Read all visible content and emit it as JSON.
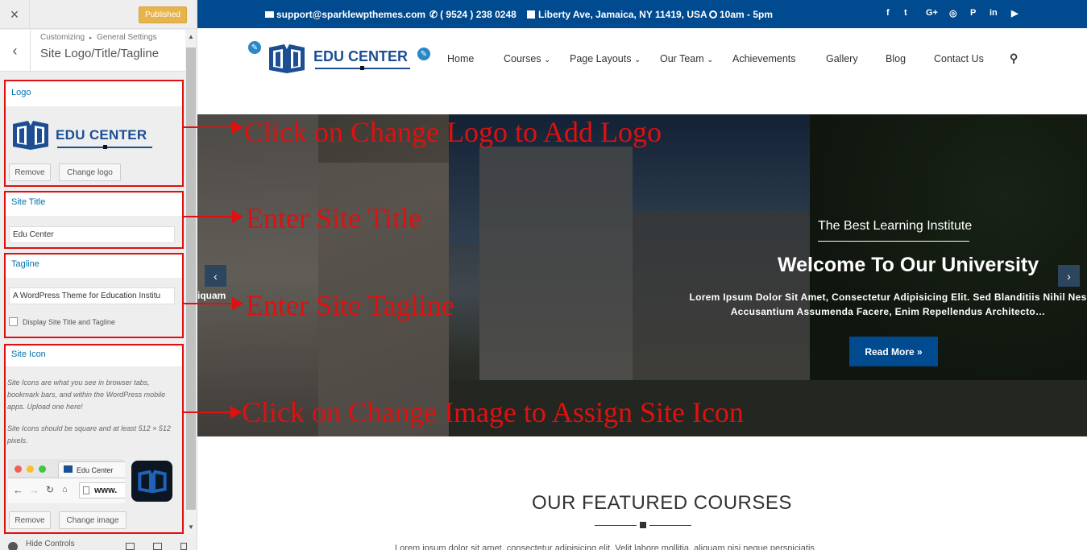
{
  "sidebar": {
    "close_glyph": "×",
    "publish_label": "Published",
    "back_glyph": "‹",
    "breadcrumb_root": "Customizing",
    "breadcrumb_sep": "▸",
    "breadcrumb_parent": "General Settings",
    "section_title": "Site Logo/Title/Tagline",
    "logo": {
      "label": "Logo",
      "logo_text": "EDU CENTER",
      "remove_label": "Remove",
      "change_label": "Change logo"
    },
    "site_title": {
      "label": "Site Title",
      "value": "Edu Center"
    },
    "tagline": {
      "label": "Tagline",
      "value": "A WordPress Theme for Education Institu",
      "checkbox_label": "Display Site Title and Tagline",
      "checked": false
    },
    "site_icon": {
      "label": "Site Icon",
      "desc1": "Site Icons are what you see in browser tabs, bookmark bars, and within the WordPress mobile apps. Upload one here!",
      "desc2": "Site Icons should be square and at least 512 × 512 pixels.",
      "browser_tab_label": "Edu Center",
      "browser_url": "www.",
      "remove_label": "Remove",
      "change_label": "Change image"
    },
    "footer_label": "Hide Controls"
  },
  "topbar": {
    "email": "support@sparklewpthemes.com",
    "phone": "( 9524 ) 238 0248",
    "address": "Liberty Ave, Jamaica, NY 11419, USA",
    "hours": "10am - 5pm",
    "social": [
      "f",
      "t",
      "G+",
      "◎",
      "P",
      "in",
      "▶"
    ]
  },
  "header": {
    "logo_text": "EDU CENTER",
    "nav": [
      "Home",
      "Courses",
      "Page Layouts",
      "Our Team",
      "Achievements",
      "Gallery",
      "Blog",
      "Contact Us"
    ],
    "nav_dropdown_glyph": "⌄",
    "search_glyph": "⚲"
  },
  "hero": {
    "subtitle": "The Best Learning Institute",
    "title": "Welcome To Our University",
    "text": "Lorem Ipsum Dolor Sit Amet, Consectetur Adipisicing Elit. Sed Blanditiis Nihil Nes Accusantium Assumenda Facere, Enim Repellendus Architecto…",
    "peek_text": "iquam",
    "button_label": "Read More »",
    "prev_glyph": "‹",
    "next_glyph": "›"
  },
  "featured": {
    "title": "OUR FEATURED COURSES",
    "text": "Lorem ipsum dolor sit amet, consectetur adipisicing elit. Velit labore mollitia, aliquam nisi neque perspiciatis"
  },
  "annotations": {
    "logo": "Click on Change Logo to Add Logo",
    "title": "Enter Site Title",
    "tagline": "Enter Site Tagline",
    "icon": "Click on Change Image to Assign Site Icon"
  },
  "colors": {
    "brand_blue": "#004a8f",
    "annotation_red": "#e01010",
    "publish_yellow": "#e7b34b",
    "customizer_link": "#0073aa"
  }
}
